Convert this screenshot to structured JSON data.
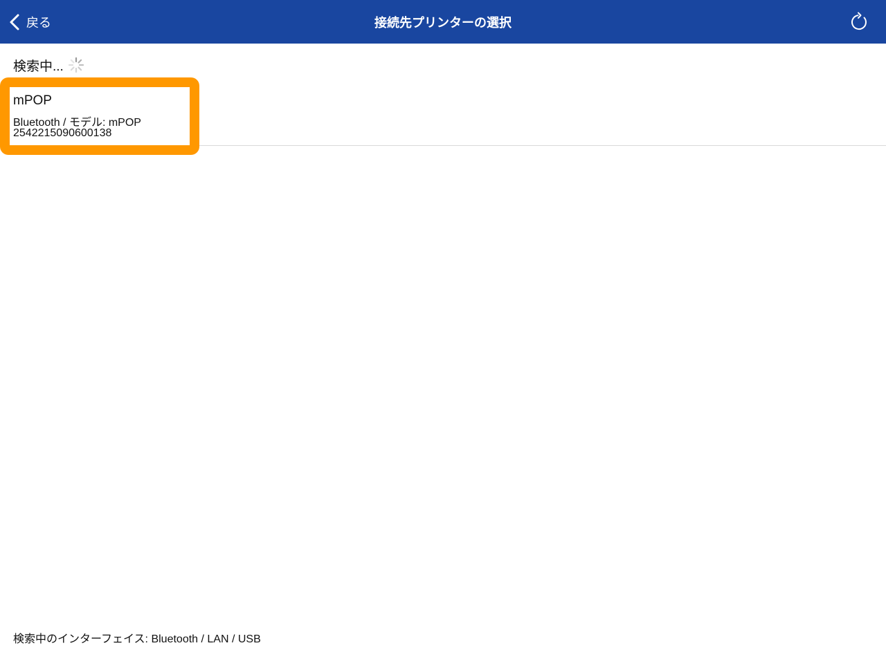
{
  "nav": {
    "back_label": "戻る",
    "title": "接続先プリンターの選択",
    "back_icon": "chevron-left-icon",
    "refresh_icon": "refresh-icon",
    "bar_color": "#1946a0"
  },
  "search": {
    "status_label": "検索中...",
    "spinner_icon": "spinner-icon"
  },
  "printers": [
    {
      "name": "mPOP",
      "detail": "Bluetooth / モデル: mPOP",
      "serial": "2542215090600138",
      "highlight_color": "#ff9800"
    }
  ],
  "footer": {
    "interfaces_label": "検索中のインターフェイス: Bluetooth / LAN / USB"
  }
}
